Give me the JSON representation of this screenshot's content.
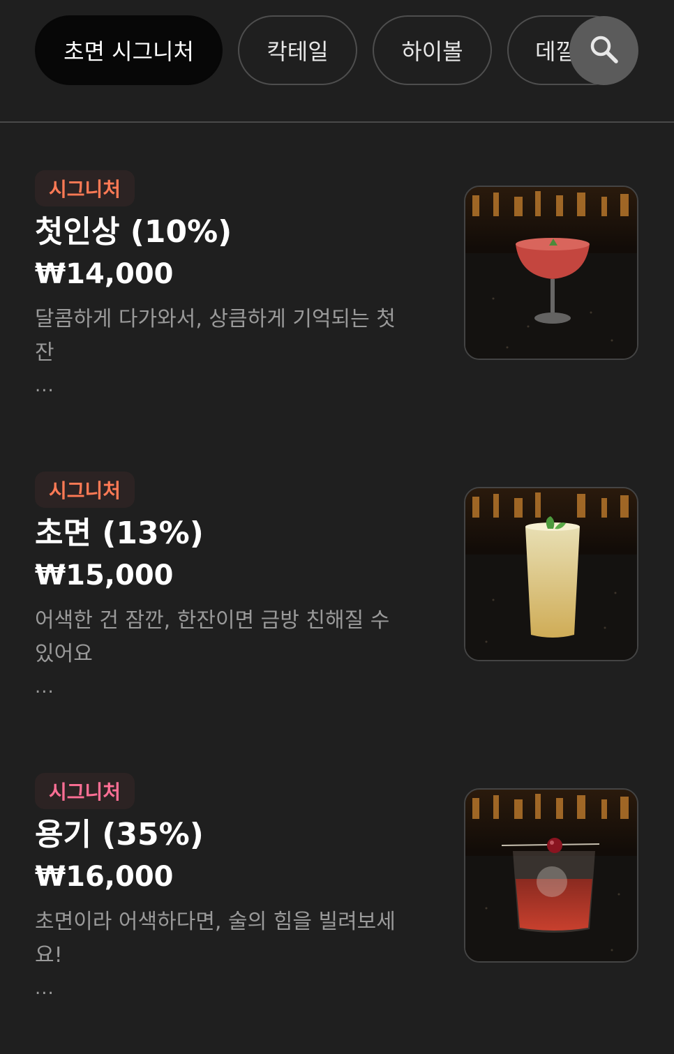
{
  "tabs": [
    {
      "label": "초면 시그니처",
      "active": true
    },
    {
      "label": "칵테일",
      "active": false
    },
    {
      "label": "하이볼",
      "active": false
    },
    {
      "label": "데낄",
      "active": false
    }
  ],
  "search": {
    "icon": "search-icon"
  },
  "menu_items": [
    {
      "badge": "시그니처",
      "badge_color": "#ff7a55",
      "name": "첫인상 (10%)",
      "price": "₩14,000",
      "description": "달콤하게 다가와서, 상큼하게 기억되는 첫 잔",
      "more": "...",
      "image": "pink-coupe-cocktail-photo"
    },
    {
      "badge": "시그니처",
      "badge_color": "#ff7a55",
      "name": "초면 (13%)",
      "price": "₩15,000",
      "description": "어색한 건 잠깐, 한잔이면 금방 친해질 수 있어요",
      "more": "...",
      "image": "highball-cocktail-photo"
    },
    {
      "badge": "시그니처",
      "badge_color": "#ff6f95",
      "name": "용기 (35%)",
      "price": "₩16,000",
      "description": "초면이라 어색하다면, 술의 힘을 빌려보세요!",
      "more": "...",
      "image": "old-fashioned-cocktail-photo"
    }
  ]
}
